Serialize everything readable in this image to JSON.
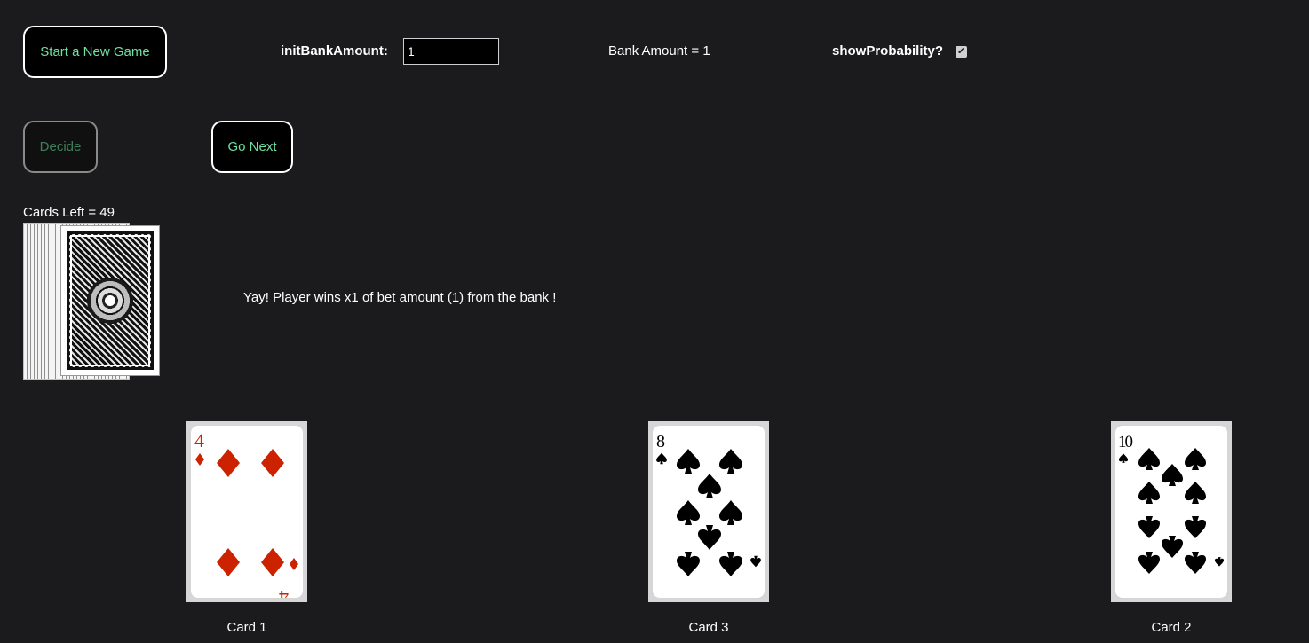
{
  "controls": {
    "new_game_label": "Start a New Game",
    "init_bank_label": "initBankAmount:",
    "init_bank_value": "1",
    "bank_amount_text": "Bank Amount = 1",
    "show_probability_label": "showProbability?",
    "show_probability_checked": true,
    "decide_label": "Decide",
    "decide_disabled": true,
    "go_next_label": "Go Next"
  },
  "deck": {
    "cards_left_text": "Cards Left = 49"
  },
  "message": "Yay! Player wins x1 of bet amount (1) from the bank !",
  "cards": [
    {
      "label": "Card 1",
      "rank": "4",
      "suit": "diamonds",
      "color": "#cc2200"
    },
    {
      "label": "Card 3",
      "rank": "8",
      "suit": "spades",
      "color": "#000000"
    },
    {
      "label": "Card 2",
      "rank": "10",
      "suit": "spades",
      "color": "#000000"
    }
  ],
  "colors": {
    "background": "#1b1b1d",
    "button_text": "#70e0a0",
    "red_suit": "#cc2200"
  }
}
